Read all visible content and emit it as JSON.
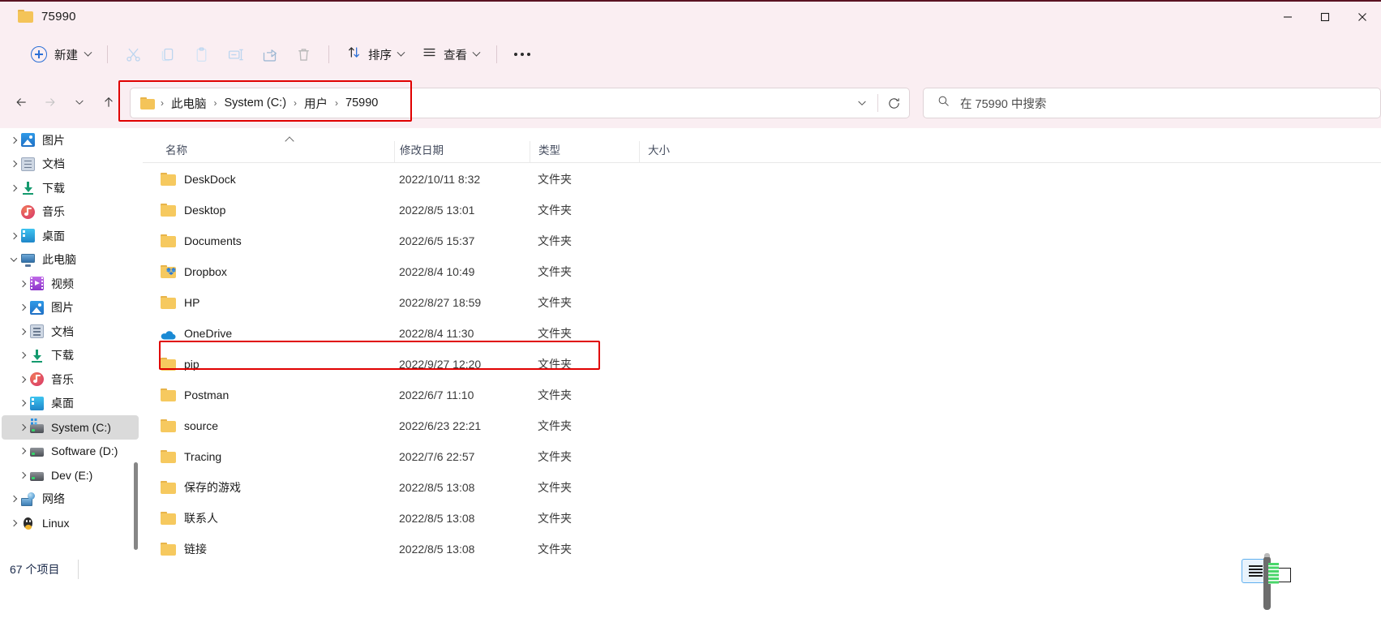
{
  "window": {
    "title": "75990",
    "title_icon": "folder-icon",
    "controls": {
      "minimize": "minimize-icon",
      "maximize": "maximize-icon",
      "close": "close-icon"
    }
  },
  "toolbar": {
    "new_label": "新建",
    "new_icon": "plus-circle-icon",
    "cut_icon": "scissors-icon",
    "copy_icon": "copy-icon",
    "paste_icon": "paste-icon",
    "rename_icon": "rename-icon",
    "share_icon": "share-icon",
    "delete_icon": "trash-icon",
    "sort_label": "排序",
    "sort_icon": "sort-arrows-icon",
    "view_label": "查看",
    "view_icon": "list-lines-icon",
    "more_icon": "ellipsis-icon"
  },
  "navigation": {
    "back_icon": "arrow-left-icon",
    "forward_icon": "arrow-right-icon",
    "recent_icon": "chevron-down-icon",
    "up_icon": "arrow-up-icon"
  },
  "address": {
    "folder_icon": "folder-icon",
    "separator": "›",
    "crumbs": [
      "此电脑",
      "System (C:)",
      "用户",
      "75990"
    ],
    "dropdown_icon": "chevron-down-icon",
    "refresh_icon": "refresh-icon"
  },
  "search": {
    "icon": "search-icon",
    "placeholder": "在 75990 中搜索",
    "value": ""
  },
  "sidebar": {
    "items": [
      {
        "label": "图片",
        "icon": "pictures-icon",
        "expandable": true,
        "expanded": false,
        "indent": 1,
        "selected": false
      },
      {
        "label": "文档",
        "icon": "documents-icon",
        "expandable": true,
        "expanded": false,
        "indent": 1,
        "selected": false
      },
      {
        "label": "下载",
        "icon": "downloads-icon",
        "expandable": true,
        "expanded": false,
        "indent": 1,
        "selected": false
      },
      {
        "label": "音乐",
        "icon": "music-icon",
        "expandable": false,
        "expanded": false,
        "indent": 1,
        "selected": false
      },
      {
        "label": "桌面",
        "icon": "desktop-icon",
        "expandable": true,
        "expanded": false,
        "indent": 1,
        "selected": false
      },
      {
        "label": "此电脑",
        "icon": "this-pc-icon",
        "expandable": true,
        "expanded": true,
        "indent": 0,
        "selected": false
      },
      {
        "label": "视频",
        "icon": "videos-icon",
        "expandable": true,
        "expanded": false,
        "indent": 2,
        "selected": false
      },
      {
        "label": "图片",
        "icon": "pictures-icon",
        "expandable": true,
        "expanded": false,
        "indent": 2,
        "selected": false
      },
      {
        "label": "文档",
        "icon": "documents-icon",
        "expandable": true,
        "expanded": false,
        "indent": 2,
        "selected": false
      },
      {
        "label": "下载",
        "icon": "downloads-icon",
        "expandable": true,
        "expanded": false,
        "indent": 2,
        "selected": false
      },
      {
        "label": "音乐",
        "icon": "music-icon",
        "expandable": true,
        "expanded": false,
        "indent": 2,
        "selected": false
      },
      {
        "label": "桌面",
        "icon": "desktop-icon",
        "expandable": true,
        "expanded": false,
        "indent": 2,
        "selected": false
      },
      {
        "label": "System (C:)",
        "icon": "drive-system-icon",
        "expandable": true,
        "expanded": false,
        "indent": 2,
        "selected": true
      },
      {
        "label": "Software (D:)",
        "icon": "drive-icon",
        "expandable": true,
        "expanded": false,
        "indent": 2,
        "selected": false
      },
      {
        "label": "Dev (E:)",
        "icon": "drive-icon",
        "expandable": true,
        "expanded": false,
        "indent": 2,
        "selected": false
      },
      {
        "label": "网络",
        "icon": "network-icon",
        "expandable": true,
        "expanded": false,
        "indent": 0,
        "selected": false
      },
      {
        "label": "Linux",
        "icon": "linux-penguin-icon",
        "expandable": true,
        "expanded": false,
        "indent": 0,
        "selected": false
      }
    ]
  },
  "file_list": {
    "columns": [
      "名称",
      "修改日期",
      "类型",
      "大小"
    ],
    "sort_column": "名称",
    "sort_direction": "ascending",
    "rows": [
      {
        "name": "DeskDock",
        "date": "2022/10/11 8:32",
        "type": "文件夹",
        "size": "",
        "icon": "folder-icon",
        "highlighted": false
      },
      {
        "name": "Desktop",
        "date": "2022/8/5 13:01",
        "type": "文件夹",
        "size": "",
        "icon": "folder-icon",
        "highlighted": false
      },
      {
        "name": "Documents",
        "date": "2022/6/5 15:37",
        "type": "文件夹",
        "size": "",
        "icon": "folder-icon",
        "highlighted": false
      },
      {
        "name": "Dropbox",
        "date": "2022/8/4 10:49",
        "type": "文件夹",
        "size": "",
        "icon": "dropbox-folder-icon",
        "highlighted": false
      },
      {
        "name": "HP",
        "date": "2022/8/27 18:59",
        "type": "文件夹",
        "size": "",
        "icon": "folder-icon",
        "highlighted": false
      },
      {
        "name": "OneDrive",
        "date": "2022/8/4 11:30",
        "type": "文件夹",
        "size": "",
        "icon": "onedrive-cloud-icon",
        "highlighted": false
      },
      {
        "name": "pip",
        "date": "2022/9/27 12:20",
        "type": "文件夹",
        "size": "",
        "icon": "folder-icon",
        "highlighted": true
      },
      {
        "name": "Postman",
        "date": "2022/6/7 11:10",
        "type": "文件夹",
        "size": "",
        "icon": "folder-icon",
        "highlighted": false
      },
      {
        "name": "source",
        "date": "2022/6/23 22:21",
        "type": "文件夹",
        "size": "",
        "icon": "folder-icon",
        "highlighted": false
      },
      {
        "name": "Tracing",
        "date": "2022/7/6 22:57",
        "type": "文件夹",
        "size": "",
        "icon": "folder-icon",
        "highlighted": false
      },
      {
        "name": "保存的游戏",
        "date": "2022/8/5 13:08",
        "type": "文件夹",
        "size": "",
        "icon": "folder-icon",
        "highlighted": false
      },
      {
        "name": "联系人",
        "date": "2022/8/5 13:08",
        "type": "文件夹",
        "size": "",
        "icon": "folder-icon",
        "highlighted": false
      },
      {
        "name": "链接",
        "date": "2022/8/5 13:08",
        "type": "文件夹",
        "size": "",
        "icon": "folder-icon",
        "highlighted": false
      }
    ]
  },
  "status": {
    "item_count_text": "67 个项目"
  },
  "view_controls": {
    "details_view_icon": "details-view-icon",
    "details_view_active": true
  },
  "annotations": {
    "color": "#e00000",
    "targets": [
      "address-bar",
      "pip-row"
    ]
  },
  "colors": {
    "titlebar_bg": "#faeef2",
    "accent_blue": "#2b6fd6",
    "folder_yellow": "#f6c95f",
    "selection_gray": "#dadada",
    "annotation_red": "#e00000"
  }
}
